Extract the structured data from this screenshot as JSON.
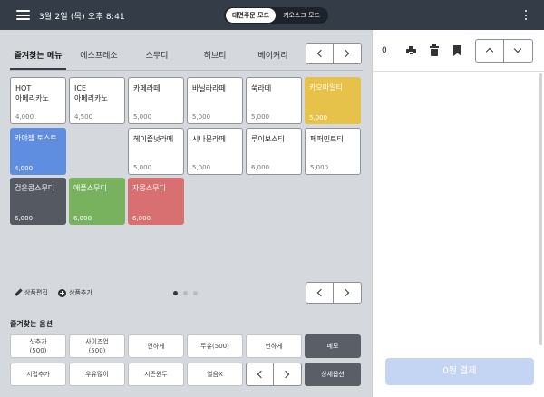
{
  "topbar": {
    "datetime": "3월 2일 (목) 오후 8:41",
    "mode_active": "대면주문 모드",
    "mode_inactive": "키오스크 모드"
  },
  "tabs": [
    {
      "label": "즐겨찾는 메뉴",
      "active": true
    },
    {
      "label": "에스프레소",
      "active": false
    },
    {
      "label": "스무디",
      "active": false
    },
    {
      "label": "허브티",
      "active": false
    },
    {
      "label": "베이커리",
      "active": false
    }
  ],
  "menu_items": [
    {
      "name": "HOT\n아메리카노",
      "price": "4,000",
      "color": "#ffffff"
    },
    {
      "name": "ICE\n아메리카노",
      "price": "4,500",
      "color": "#ffffff"
    },
    {
      "name": "카페라떼",
      "price": "5,000",
      "color": "#ffffff"
    },
    {
      "name": "바닐라라떼",
      "price": "5,000",
      "color": "#ffffff"
    },
    {
      "name": "쑥라떼",
      "price": "5,000",
      "color": "#ffffff"
    },
    {
      "name": "카모마일티",
      "price": "5,000",
      "color": "#e6c24a"
    },
    {
      "name": "카야잼 토스트",
      "price": "4,000",
      "color": "#5f8de0"
    },
    {
      "name": "헤이즐넛라떼",
      "price": "5,000",
      "color": "#ffffff"
    },
    {
      "name": "시나몬라떼",
      "price": "5,000",
      "color": "#ffffff"
    },
    {
      "name": "루이보스티",
      "price": "6,000",
      "color": "#ffffff"
    },
    {
      "name": "페퍼민트티",
      "price": "5,000",
      "color": "#ffffff"
    },
    {
      "name": "검은콩스무디",
      "price": "6,000",
      "color": "#555a62"
    },
    {
      "name": "애플스무디",
      "price": "6,000",
      "color": "#79b25f"
    },
    {
      "name": "자몽스무디",
      "price": "6,000",
      "color": "#d86f70"
    }
  ],
  "tools": {
    "edit_label": "상품편집",
    "add_label": "상품추가"
  },
  "pagination": {
    "current": 1,
    "total": 3
  },
  "options": {
    "title": "즐겨찾는 옵션",
    "items": [
      {
        "label": "샷추가",
        "sub": "(500)"
      },
      {
        "label": "사이즈업",
        "sub": "(500)"
      },
      {
        "label": "연하게",
        "sub": ""
      },
      {
        "label": "두유(500)",
        "sub": ""
      },
      {
        "label": "연하게",
        "sub": ""
      },
      {
        "label": "메모",
        "sub": ""
      },
      {
        "label": "시럽추가",
        "sub": ""
      },
      {
        "label": "우유많이",
        "sub": ""
      },
      {
        "label": "시즌원두",
        "sub": ""
      },
      {
        "label": "얼음X",
        "sub": ""
      },
      {
        "label": "상세옵션",
        "sub": ""
      }
    ]
  },
  "cart": {
    "count": "0",
    "pay_label": "0원 결제"
  },
  "colors": {
    "topbar": "#333c47",
    "pay_button": "#c4d4f3"
  }
}
